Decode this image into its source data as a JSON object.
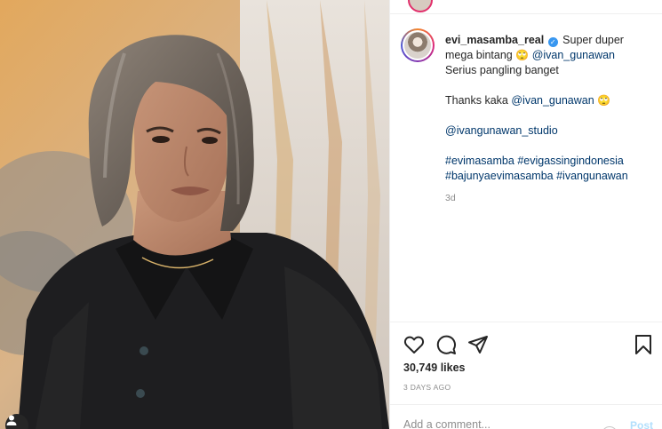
{
  "post": {
    "username": "evi_masamba_real",
    "caption_line1": "Super duper mega bintang",
    "mention1": "@ivan_gunawan",
    "caption_line2": "Serius pangling banget",
    "thanks": "Thanks kaka",
    "mention2": "@ivan_gunawan",
    "mention3": "@ivangunawan_studio",
    "hashtags_line1": [
      "#evimasamba",
      "#evigassingindonesia"
    ],
    "hashtags_line2": [
      "#bajunyaevimasamba",
      "#ivangunawan"
    ],
    "emoji": "🙄",
    "caption_age": "3d",
    "likes": "30,749 likes",
    "posted_ago": "3 DAYS AGO"
  },
  "comment": {
    "placeholder": "Add a comment...",
    "post_label": "Post"
  },
  "icons": {
    "like": "heart-icon",
    "comment": "comment-icon",
    "share": "paper-plane-icon",
    "save": "bookmark-icon",
    "verified": "verified-badge-icon",
    "user_tags": "user-tag-icon"
  },
  "colors": {
    "link": "#00376b",
    "verified": "#3897f0",
    "post_button": "#b2dffc"
  }
}
